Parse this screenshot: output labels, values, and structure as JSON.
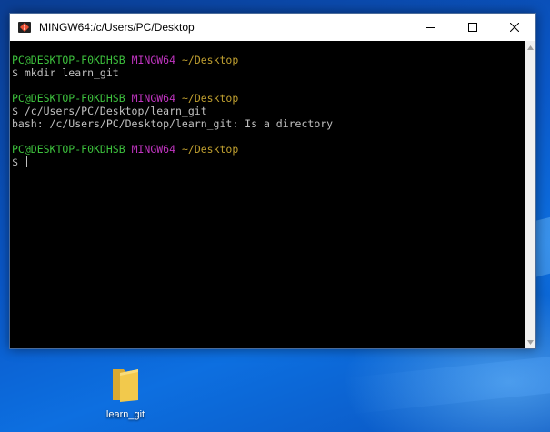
{
  "window": {
    "title": "MINGW64:/c/Users/PC/Desktop",
    "controls": {
      "minimize": "minimize",
      "maximize": "maximize",
      "close": "close"
    }
  },
  "terminal": {
    "blocks": [
      {
        "prompt": {
          "user_host": "PC@DESKTOP-F0KDHSB",
          "system": "MINGW64",
          "path": "~/Desktop"
        },
        "command": "$ mkdir learn_git",
        "output": ""
      },
      {
        "prompt": {
          "user_host": "PC@DESKTOP-F0KDHSB",
          "system": "MINGW64",
          "path": "~/Desktop"
        },
        "command": "$ /c/Users/PC/Desktop/learn_git",
        "output": "bash: /c/Users/PC/Desktop/learn_git: Is a directory"
      },
      {
        "prompt": {
          "user_host": "PC@DESKTOP-F0KDHSB",
          "system": "MINGW64",
          "path": "~/Desktop"
        },
        "command": "$ ",
        "output": ""
      }
    ]
  },
  "desktop": {
    "icons": [
      {
        "label": "learn_git",
        "icon": "folder-icon"
      }
    ]
  },
  "colors": {
    "prompt_user": "#3dc13d",
    "prompt_system": "#c034c0",
    "prompt_path": "#c0a030",
    "text": "#c0c0c0",
    "terminal_bg": "#000000"
  }
}
